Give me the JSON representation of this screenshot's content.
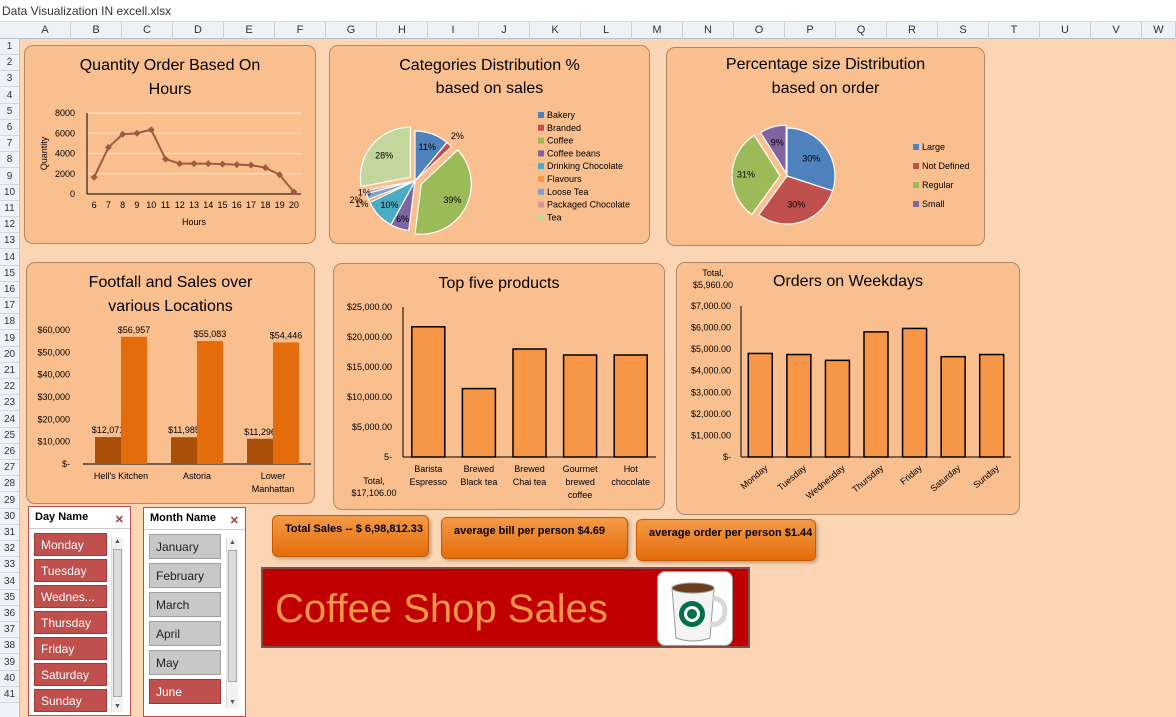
{
  "window": {
    "title": "Data Visualization IN excell.xlsx"
  },
  "sheet": {
    "columns": [
      "A",
      "B",
      "C",
      "D",
      "E",
      "F",
      "G",
      "H",
      "I",
      "J",
      "K",
      "L",
      "M",
      "N",
      "O",
      "P",
      "Q",
      "R",
      "S",
      "T",
      "U",
      "V",
      "W"
    ],
    "rows": [
      "1",
      "2",
      "3",
      "4",
      "5",
      "6",
      "7",
      "8",
      "9",
      "10",
      "11",
      "12",
      "13",
      "14",
      "15",
      "16",
      "17",
      "18",
      "19",
      "20",
      "21",
      "22",
      "23",
      "24",
      "25",
      "26",
      "27",
      "28",
      "29",
      "30",
      "31",
      "32",
      "33",
      "34",
      "35",
      "36",
      "37",
      "38",
      "39",
      "40",
      "41"
    ]
  },
  "charts": {
    "hours": {
      "title_line1": "Quantity Order Based On",
      "title_line2": "Hours",
      "chart_data": {
        "type": "line",
        "title": "Quantity Order Based On Hours",
        "xlabel": "Hours",
        "ylabel": "Quantity",
        "x": [
          6,
          7,
          8,
          9,
          10,
          11,
          12,
          13,
          14,
          15,
          16,
          17,
          18,
          19,
          20
        ],
        "values": [
          1650,
          4600,
          5900,
          6000,
          6350,
          3450,
          3000,
          3000,
          3000,
          2950,
          2900,
          2850,
          2600,
          1900,
          200
        ],
        "ylim": [
          0,
          8000
        ],
        "yticks": [
          "0",
          "2000",
          "4000",
          "6000",
          "8000"
        ],
        "grid": true,
        "color": "#a05a40"
      }
    },
    "categories": {
      "title_line1": "Categories Distribution %",
      "title_line2": "based on sales",
      "chart_data": {
        "type": "pie",
        "title": "Categories Distribution % based on sales",
        "categories": [
          "Bakery",
          "Branded",
          "Coffee",
          "Coffee beans",
          "Drinking Chocolate",
          "Flavours",
          "Loose Tea",
          "Packaged Chocolate",
          "Tea"
        ],
        "values": [
          11,
          2,
          39,
          6,
          10,
          1,
          2,
          1,
          28
        ],
        "labels": [
          "11%",
          "2%",
          "39%",
          "6%",
          "10%",
          "1%",
          "2%",
          "1%",
          "28%"
        ],
        "colors": [
          "#4f81bd",
          "#c0504d",
          "#9bbb59",
          "#8064a2",
          "#4bacc6",
          "#f79646",
          "#7f9fd1",
          "#d99694",
          "#c3d69b"
        ],
        "legend": "right"
      }
    },
    "sizes": {
      "title_line1": "Percentage  size Distribution",
      "title_line2": "based on order",
      "chart_data": {
        "type": "pie",
        "title": "Percentage size Distribution based on order",
        "categories": [
          "Large",
          "Not Defined",
          "Regular",
          "Small"
        ],
        "values": [
          30,
          30,
          31,
          9
        ],
        "labels": [
          "30%",
          "30%",
          "31%",
          "9%"
        ],
        "colors": [
          "#4f81bd",
          "#c0504d",
          "#9bbb59",
          "#8064a2"
        ],
        "legend": "right"
      }
    },
    "locations": {
      "title_line1": "Footfall and Sales over",
      "title_line2": "various Locations",
      "chart_data": {
        "type": "bar",
        "title": "Footfall and Sales over various Locations",
        "categories": [
          "Hell's Kitchen",
          "Astoria",
          "Lower Manhattan"
        ],
        "series": [
          {
            "values": [
              12071,
              11985,
              11296
            ],
            "labels": [
              "$12,071",
              "$11,985",
              "$11,296"
            ],
            "color": "#a84f0a"
          },
          {
            "values": [
              56957,
              55083,
              54446
            ],
            "labels": [
              "$56,957",
              "$55,083",
              "$54,446"
            ],
            "color": "#e46c0a"
          }
        ],
        "ylim": [
          0,
          60000
        ],
        "yticks": [
          "$-",
          "$10,000",
          "$20,000",
          "$30,000",
          "$40,000",
          "$50,000",
          "$60,000"
        ]
      }
    },
    "products": {
      "title": "Top five products",
      "total_line1": "Total,",
      "total_line2": "$17,106.00",
      "chart_data": {
        "type": "bar",
        "title": "Top five products",
        "categories": [
          "Barista Espresso",
          "Brewed Black tea",
          "Brewed Chai tea",
          "Gourmet brewed coffee",
          "Hot chocolate"
        ],
        "category_lines": [
          [
            "Barista",
            "Espresso"
          ],
          [
            "Brewed",
            "Black tea"
          ],
          [
            "Brewed",
            "Chai tea"
          ],
          [
            "Gourmet",
            "brewed",
            "coffee"
          ],
          [
            "Hot",
            "chocolate"
          ]
        ],
        "values": [
          21700,
          11400,
          18000,
          17000,
          17000
        ],
        "ylim": [
          0,
          25000
        ],
        "yticks": [
          "5-",
          "$5,000.00",
          "$10,000.00",
          "$15,000.00",
          "$20,000.00",
          "$25,000.00"
        ],
        "color": "#f79646"
      }
    },
    "weekdays": {
      "title": "Orders on Weekdays",
      "total_line1": "Total,",
      "total_line2": "$5,960.00",
      "chart_data": {
        "type": "bar",
        "title": "Orders on Weekdays",
        "categories": [
          "Monday",
          "Tuesday",
          "Wednesday",
          "Thursday",
          "Friday",
          "Saturday",
          "Sunday"
        ],
        "values": [
          4800,
          4750,
          4480,
          5800,
          5960,
          4650,
          4750
        ],
        "ylim": [
          0,
          7000
        ],
        "yticks": [
          "$-",
          "$1,000.00",
          "$2,000.00",
          "$3,000.00",
          "$4,000.00",
          "$5,000.00",
          "$6,000.00",
          "$7,000.00"
        ],
        "color": "#f79646"
      }
    }
  },
  "slicers": {
    "day": {
      "title": "Day Name",
      "items": [
        "Monday",
        "Tuesday",
        "Wednes...",
        "Thursday",
        "Friday",
        "Saturday",
        "Sunday"
      ]
    },
    "month": {
      "title": "Month Name",
      "items": [
        "January",
        "February",
        "March",
        "April",
        "May",
        "June"
      ],
      "selected": [
        false,
        false,
        false,
        false,
        false,
        true
      ]
    }
  },
  "kpis": {
    "total_sales": "Total Sales -- $  6,98,812.33",
    "avg_bill": "average bill per person   $4.69",
    "avg_order": "average order per person  $1.44"
  },
  "banner": {
    "text": "Coffee Shop Sales"
  }
}
